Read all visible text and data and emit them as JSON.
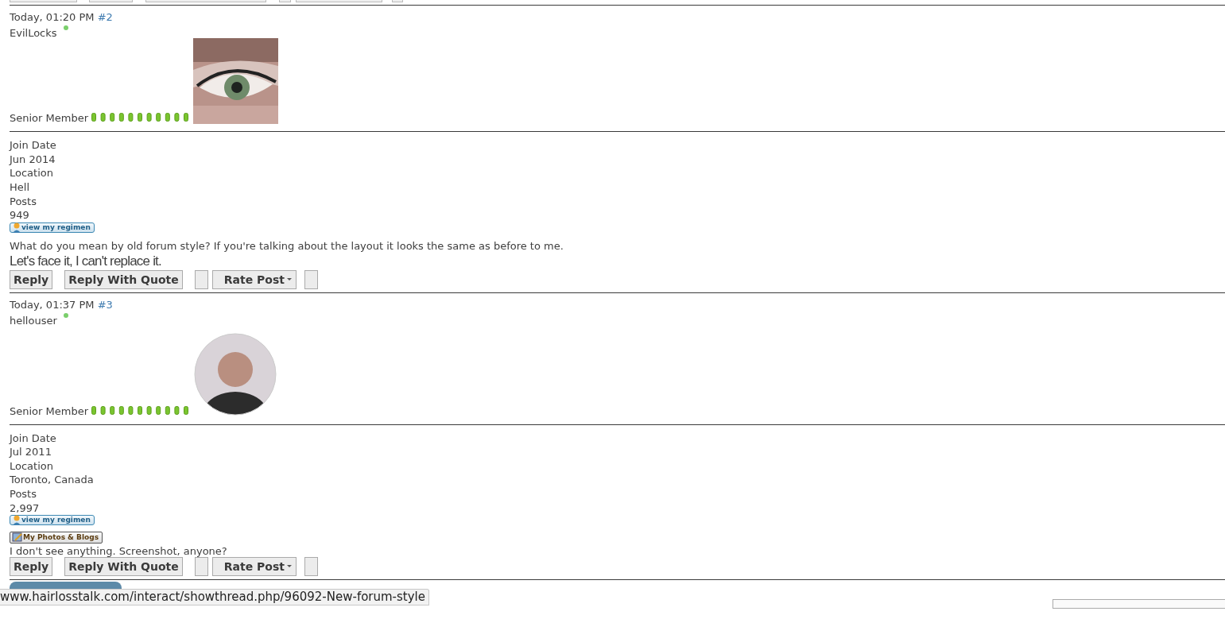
{
  "posts": [
    {
      "date": "Today, 01:20 PM",
      "number": "#2",
      "username": "EvilLocks",
      "online": true,
      "rank": "Senior Member",
      "avatar": {
        "kind": "picture"
      },
      "info": [
        {
          "label": "Join Date",
          "value": "Jun 2014"
        },
        {
          "label": "Location",
          "value": "Hell"
        },
        {
          "label": "Posts",
          "value": "949"
        }
      ],
      "badges": [
        {
          "kind": "regimen",
          "text": "view my regimen"
        }
      ],
      "message": "What do you mean by old forum style? If you're talking about the layout it looks the same as before to me.",
      "signature": "Let's face it, I can't replace it.",
      "buttons": [
        {
          "kind": "plain",
          "label": "Reply"
        },
        {
          "kind": "plain",
          "label": "Reply With Quote"
        },
        {
          "kind": "blank"
        },
        {
          "kind": "dropdown",
          "label": "Rate Post"
        },
        {
          "kind": "blank"
        }
      ]
    },
    {
      "date": "Today, 01:37 PM",
      "number": "#3",
      "username": "hellouser",
      "online": true,
      "rank": "Senior Member",
      "avatar": {
        "kind": "person"
      },
      "info": [
        {
          "label": "Join Date",
          "value": "Jul 2011"
        },
        {
          "label": "Location",
          "value": "Toronto, Canada"
        },
        {
          "label": "Posts",
          "value": "2,997"
        }
      ],
      "badges": [
        {
          "kind": "regimen",
          "text": "view my regimen"
        },
        {
          "kind": "photos",
          "text": "My Photos & Blogs"
        }
      ],
      "message": "I don't see anything. Screenshot, anyone?",
      "buttons": [
        {
          "kind": "plain",
          "label": "Reply"
        },
        {
          "kind": "plain",
          "label": "Reply With Quote"
        },
        {
          "kind": "blank"
        },
        {
          "kind": "dropdown",
          "label": "Rate Post"
        },
        {
          "kind": "blank"
        }
      ]
    }
  ],
  "status_bar": {
    "url": "www.hairlosstalk.com/interact/showthread.php/96092-New-forum-style"
  }
}
